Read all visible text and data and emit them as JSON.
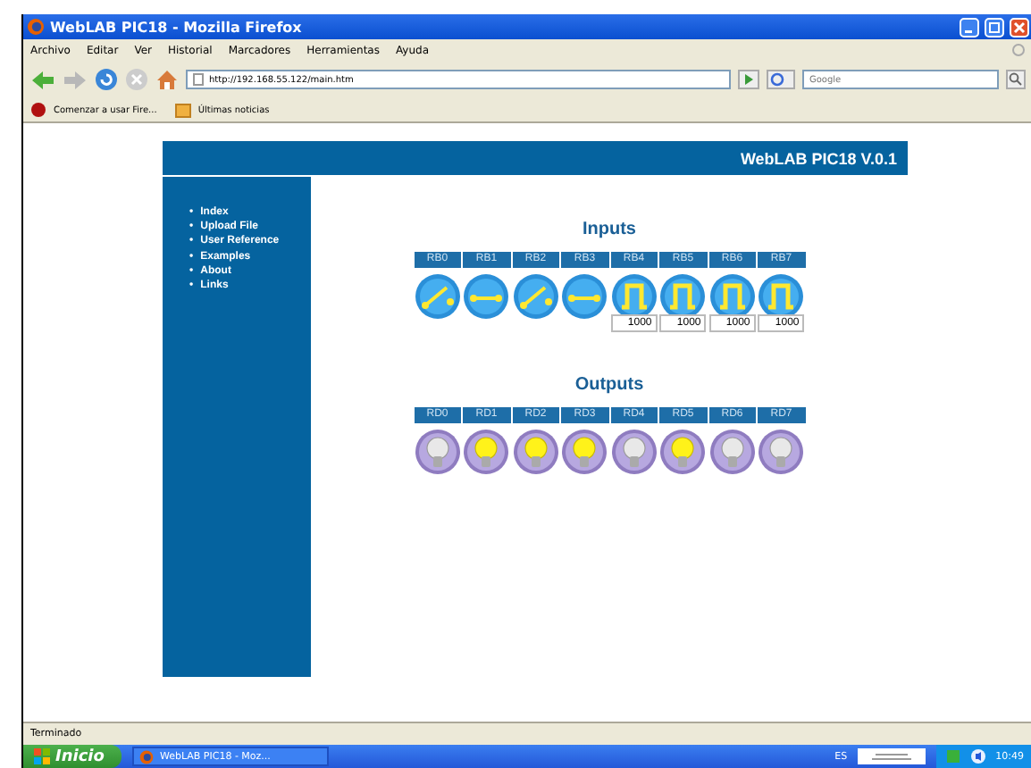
{
  "window": {
    "title": "WebLAB PIC18 - Mozilla Firefox"
  },
  "menu": [
    "Archivo",
    "Editar",
    "Ver",
    "Historial",
    "Marcadores",
    "Herramientas",
    "Ayuda"
  ],
  "address": {
    "value": "http://192.168.55.122/main.htm"
  },
  "search": {
    "placeholder": "Google"
  },
  "bookmarks": [
    "Comenzar a usar Fire...",
    "Últimas noticias"
  ],
  "page": {
    "header": "WebLAB PIC18 V.0.1",
    "nav": [
      {
        "bullet": "•",
        "label": "Index"
      },
      {
        "bullet": "•",
        "label": "Upload File"
      },
      {
        "bullet": "•",
        "label": "User Reference"
      },
      {
        "bullet": "•",
        "label": "Examples"
      },
      {
        "bullet": "•",
        "label": "About"
      },
      {
        "bullet": "•",
        "label": "Links"
      }
    ],
    "inputs": {
      "title": "Inputs",
      "pins": [
        {
          "label": "RB0",
          "kind": "switch",
          "closed": false
        },
        {
          "label": "RB1",
          "kind": "switch",
          "closed": true
        },
        {
          "label": "RB2",
          "kind": "switch",
          "closed": false
        },
        {
          "label": "RB3",
          "kind": "switch",
          "closed": true
        },
        {
          "label": "RB4",
          "kind": "pulse",
          "value": "1000"
        },
        {
          "label": "RB5",
          "kind": "pulse",
          "value": "1000"
        },
        {
          "label": "RB6",
          "kind": "pulse",
          "value": "1000"
        },
        {
          "label": "RB7",
          "kind": "pulse",
          "value": "1000"
        }
      ]
    },
    "outputs": {
      "title": "Outputs",
      "pins": [
        {
          "label": "RD0",
          "on": false
        },
        {
          "label": "RD1",
          "on": true
        },
        {
          "label": "RD2",
          "on": true
        },
        {
          "label": "RD3",
          "on": true
        },
        {
          "label": "RD4",
          "on": false
        },
        {
          "label": "RD5",
          "on": true
        },
        {
          "label": "RD6",
          "on": false
        },
        {
          "label": "RD7",
          "on": false
        }
      ]
    }
  },
  "status_bar": "Terminado",
  "taskbar": {
    "start": "Inicio",
    "task": "WebLAB PIC18 - Moz...",
    "language": "ES",
    "clock": "10:49"
  }
}
